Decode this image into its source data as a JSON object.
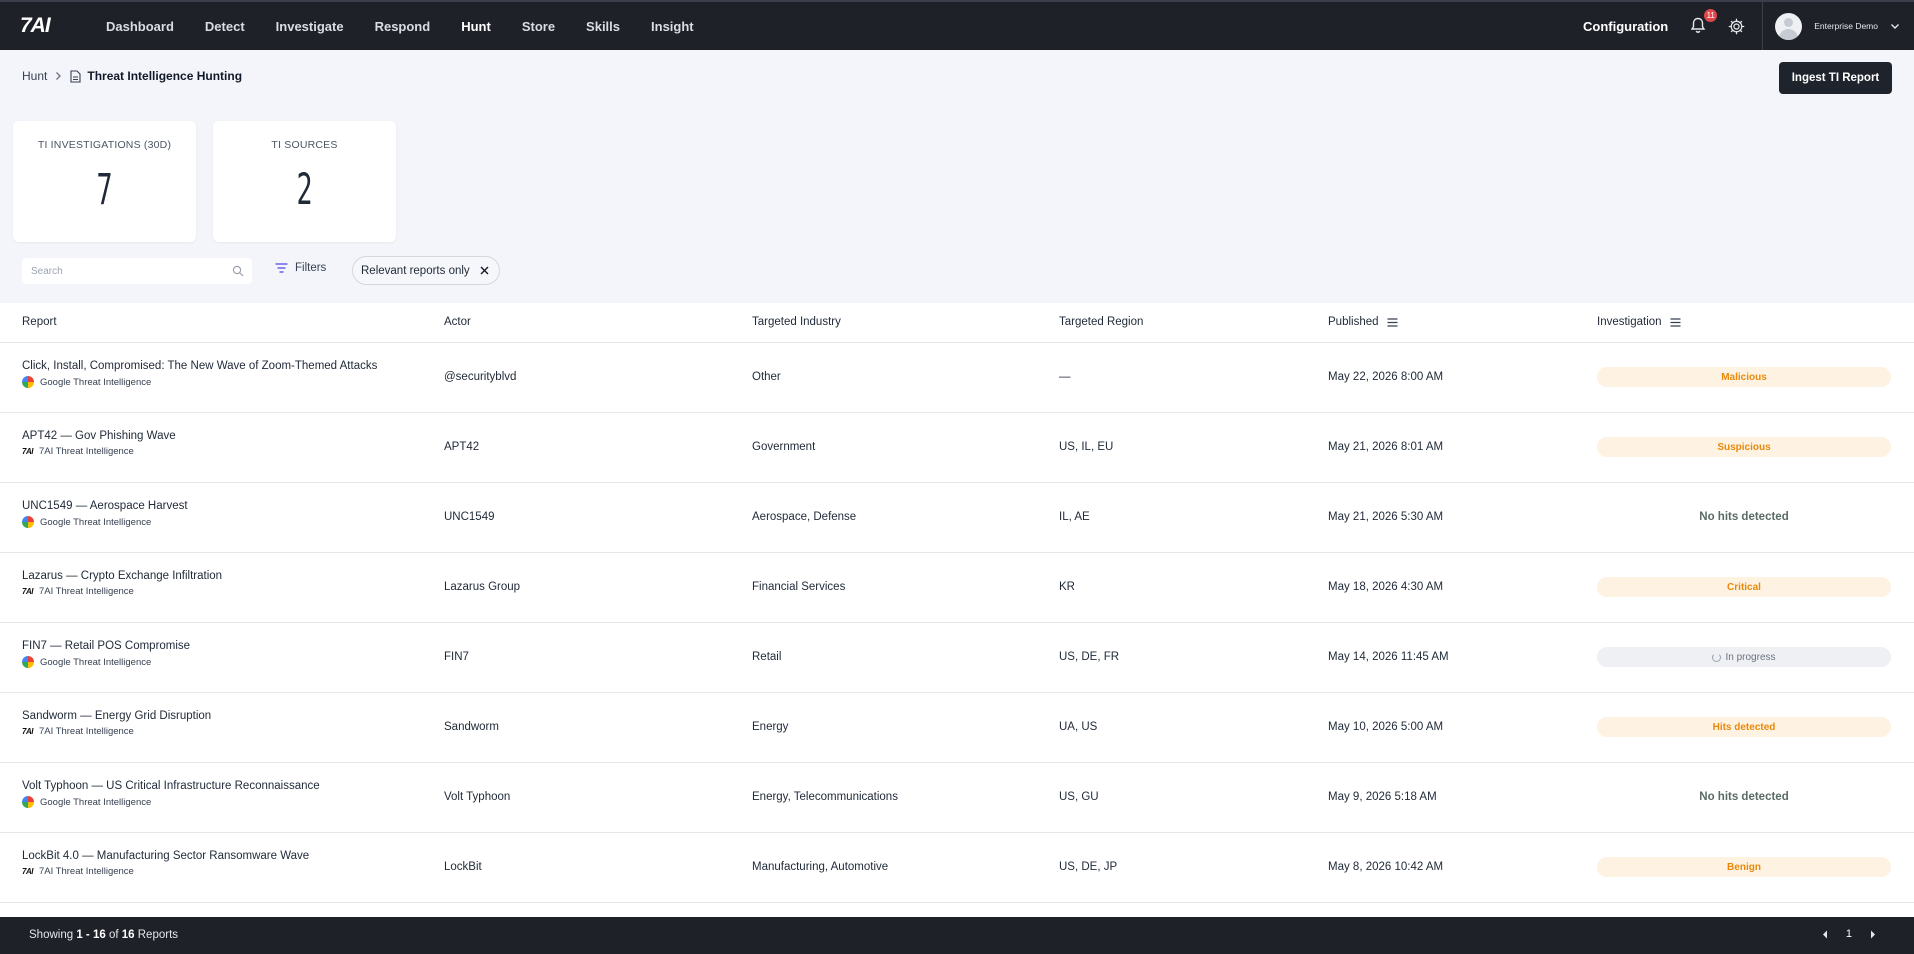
{
  "nav": {
    "logo": "7AI",
    "items": [
      "Dashboard",
      "Detect",
      "Investigate",
      "Respond",
      "Hunt",
      "Store",
      "Skills",
      "Insight"
    ],
    "active": "Hunt",
    "configuration": "Configuration",
    "notification_count": "11",
    "user_name": "Enterprise Demo"
  },
  "breadcrumb": {
    "parent": "Hunt",
    "current": "Threat Intelligence Hunting"
  },
  "ingest_button": "Ingest TI Report",
  "stats": [
    {
      "label": "TI INVESTIGATIONS (30D)",
      "value": "7"
    },
    {
      "label": "TI SOURCES",
      "value": "2"
    }
  ],
  "toolbar": {
    "search_placeholder": "Search",
    "filters_label": "Filters",
    "chip_label": "Relevant reports only"
  },
  "table": {
    "columns": [
      "Report",
      "Actor",
      "Targeted Industry",
      "Targeted Region",
      "Published",
      "Investigation"
    ],
    "rows": [
      {
        "title": "Click, Install, Compromised: The New Wave of Zoom-Themed Attacks",
        "source": "Google Threat Intelligence",
        "source_icon": "google-ti-icon",
        "actor": "@securityblvd",
        "industry": "Other",
        "region": "—",
        "published": "May 22, 2026 8:00 AM",
        "investigation": "Malicious",
        "status_style": "orange"
      },
      {
        "title": "APT42 — Gov Phishing Wave",
        "source": "7AI Threat Intelligence",
        "source_icon": "7ai-icon",
        "actor": "APT42",
        "industry": "Government",
        "region": "US, IL, EU",
        "published": "May 21, 2026 8:01 AM",
        "investigation": "Suspicious",
        "status_style": "orange"
      },
      {
        "title": "UNC1549 — Aerospace Harvest",
        "source": "Google Threat Intelligence",
        "source_icon": "google-ti-icon",
        "actor": "UNC1549",
        "industry": "Aerospace, Defense",
        "region": "IL, AE",
        "published": "May 21, 2026 5:30 AM",
        "investigation": "No hits detected",
        "status_style": "plain"
      },
      {
        "title": "Lazarus — Crypto Exchange Infiltration",
        "source": "7AI Threat Intelligence",
        "source_icon": "7ai-icon",
        "actor": "Lazarus Group",
        "industry": "Financial Services",
        "region": "KR",
        "published": "May 18, 2026 4:30 AM",
        "investigation": "Critical",
        "status_style": "orange"
      },
      {
        "title": "FIN7 — Retail POS Compromise",
        "source": "Google Threat Intelligence",
        "source_icon": "google-ti-icon",
        "actor": "FIN7",
        "industry": "Retail",
        "region": "US, DE, FR",
        "published": "May 14, 2026 11:45 AM",
        "investigation": "In progress",
        "status_style": "gray"
      },
      {
        "title": "Sandworm — Energy Grid Disruption",
        "source": "7AI Threat Intelligence",
        "source_icon": "7ai-icon",
        "actor": "Sandworm",
        "industry": "Energy",
        "region": "UA, US",
        "published": "May 10, 2026 5:00 AM",
        "investigation": "Hits detected",
        "status_style": "orange"
      },
      {
        "title": "Volt Typhoon — US Critical Infrastructure Reconnaissance",
        "source": "Google Threat Intelligence",
        "source_icon": "google-ti-icon",
        "actor": "Volt Typhoon",
        "industry": "Energy, Telecommunications",
        "region": "US, GU",
        "published": "May 9, 2026 5:18 AM",
        "investigation": "No hits detected",
        "status_style": "plain"
      },
      {
        "title": "LockBit 4.0 — Manufacturing Sector Ransomware Wave",
        "source": "7AI Threat Intelligence",
        "source_icon": "7ai-icon",
        "actor": "LockBit",
        "industry": "Manufacturing, Automotive",
        "region": "US, DE, JP",
        "published": "May 8, 2026 10:42 AM",
        "investigation": "Benign",
        "status_style": "orange"
      }
    ]
  },
  "footer": {
    "prefix": "Showing",
    "range": "1 - 16",
    "of": "of",
    "total": "16",
    "suffix": "Reports",
    "page": "1"
  }
}
